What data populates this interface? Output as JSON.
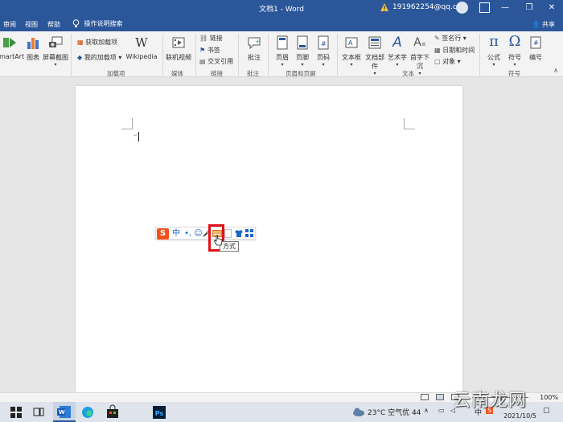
{
  "window": {
    "title": "文档1 - Word",
    "account": "191962254@qq.com",
    "min_glyph": "—",
    "restore_glyph": "❐",
    "close_glyph": "✕"
  },
  "menu": {
    "items": [
      "审阅",
      "视图",
      "帮助"
    ],
    "tell_me": "操作说明搜索",
    "share": "共享"
  },
  "ribbon": {
    "buttons": {
      "smartart": "SmartArt",
      "chart": "图表",
      "screenshot": "屏幕截图",
      "get_addins": "获取加载项",
      "my_addins": "我的加载项",
      "wikipedia": "Wikipedia",
      "online_video": "联机视频",
      "link": "链接",
      "bookmark": "书签",
      "cross_ref": "交叉引用",
      "comment": "批注",
      "header": "页眉",
      "footer": "页脚",
      "page_number": "页码",
      "text_box": "文本框",
      "quick_parts": "文档部件",
      "wordart": "艺术字",
      "drop_cap": "首字下沉",
      "signature_line": "签名行",
      "date_time": "日期和时间",
      "object": "对象",
      "equation": "公式",
      "symbol": "符号",
      "number": "编号"
    },
    "groups": {
      "addins": "加载项",
      "media": "媒体",
      "links": "链接",
      "comments": "批注",
      "header_footer": "页眉和页脚",
      "text": "文本",
      "symbols": "符号"
    }
  },
  "document": {
    "cursor_mark": "↵"
  },
  "ime": {
    "logo": "S",
    "lang": "中",
    "punct": "•,",
    "emoji": "☺",
    "voice": "🎤",
    "tooltip": "方式"
  },
  "status": {
    "zoom": "100%"
  },
  "taskbar": {
    "time": "",
    "date": "2021/10/5",
    "weather": "23°C 空气优 44",
    "ime_lang": "中",
    "ps_label": "Ps"
  },
  "watermark": "云南龙网",
  "colors": {
    "word_blue": "#2b579a",
    "highlight_red": "#e0131b",
    "sogou_orange": "#f4511e"
  }
}
